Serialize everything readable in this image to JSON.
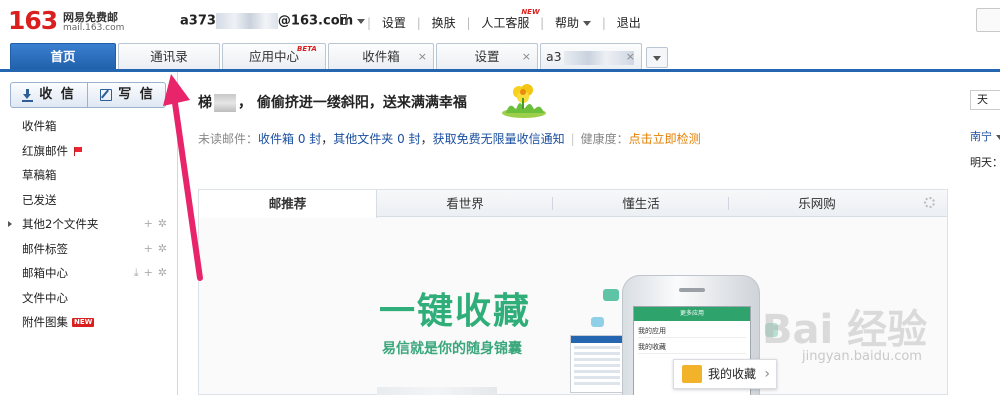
{
  "brand": {
    "logo_number": "163",
    "logo_name": "网易免费邮",
    "logo_domain": "mail.163.com"
  },
  "header": {
    "account_prefix": "a373",
    "account_suffix": "@163.com",
    "links": [
      "设置",
      "换肤",
      "人工客服",
      "帮助",
      "退出"
    ],
    "new_mark": "NEW"
  },
  "tabs": [
    {
      "label": "首页"
    },
    {
      "label": "通讯录"
    },
    {
      "label": "应用中心",
      "badge": "BETA"
    },
    {
      "label": "收件箱"
    },
    {
      "label": "设置"
    },
    {
      "label": "a3"
    }
  ],
  "sidebar": {
    "receive_label": "收 信",
    "write_label": "写 信",
    "folders": [
      {
        "label": "收件箱"
      },
      {
        "label": "红旗邮件"
      },
      {
        "label": "草稿箱"
      },
      {
        "label": "已发送"
      },
      {
        "label": "其他2个文件夹"
      },
      {
        "label": "邮件标签"
      },
      {
        "label": "邮箱中心"
      },
      {
        "label": "文件中心"
      },
      {
        "label": "附件图集",
        "badge": "NEW"
      }
    ]
  },
  "main": {
    "greeting_prefix": "梯",
    "greeting_text": "，  偷偷挤进一缕斜阳，送来满满幸福",
    "stats": {
      "unread_label": "未读邮件：",
      "inbox": "收件箱 0 封",
      "other": "其他文件夹 0 封",
      "notice_link": "获取免费无限量收信通知",
      "health_label": "健康度：",
      "health_link": "点击立即检测"
    },
    "panel_tabs": [
      "邮推荐",
      "看世界",
      "懂生活",
      "乐网购"
    ],
    "promo": {
      "title": "一键收藏",
      "subtitle": "易信就是你的随身锦囊",
      "card_text": "我的收藏",
      "phone_header": "更多应用",
      "phone_row1": "我的应用",
      "phone_row2": "我的收藏"
    }
  },
  "rightcol": {
    "weather_tab": "天",
    "city": "南宁",
    "tomorrow": "明天："
  },
  "watermark": {
    "text": "Bai 经验",
    "url": "jingyan.baidu.com"
  },
  "colors": {
    "brand_red": "#d9201f",
    "primary_blue": "#2467b0",
    "promo_green": "#2fae7a",
    "link_blue": "#1a4fa0",
    "link_orange": "#e37f00",
    "annotation_pink": "#e8256a"
  }
}
